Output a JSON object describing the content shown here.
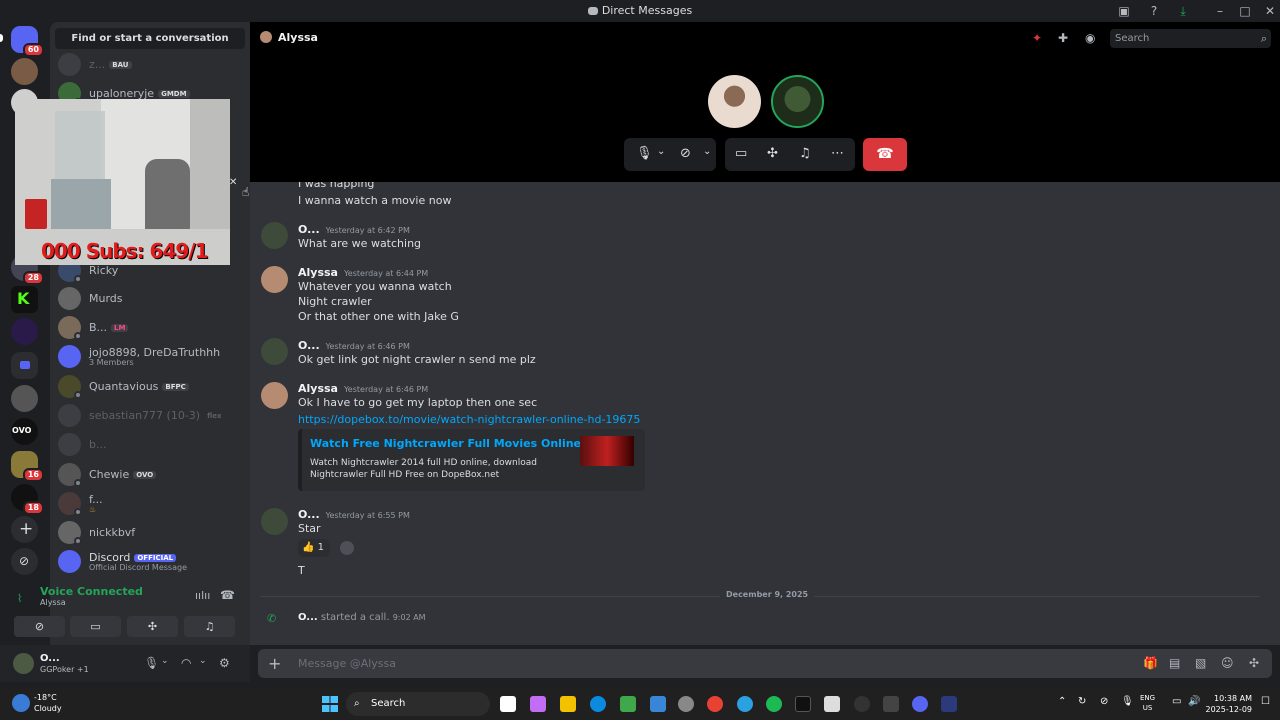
{
  "window": {
    "title": "Direct Messages"
  },
  "rail": {
    "badges": {
      "home": "60",
      "s1": "28",
      "s2": "16",
      "s3": "18"
    }
  },
  "sidebar": {
    "find_placeholder": "Find or start a conversation",
    "dms": [
      {
        "name": "z...",
        "tag": "BAU"
      },
      {
        "name": "upaloneryje",
        "tag": "GMDM"
      },
      {
        "name": "Ricky",
        "tag": ""
      },
      {
        "name": "Murds",
        "tag": ""
      },
      {
        "name": "B...",
        "tag": "LM"
      },
      {
        "name": "jojo8898, DreDaTruthhh",
        "sub": "3 Members",
        "tag": ""
      },
      {
        "name": "Quantavious",
        "tag": "BFPC"
      },
      {
        "name": "sebastian777 (10-3)",
        "tag": "flex"
      },
      {
        "name": "b...",
        "tag": ""
      },
      {
        "name": "Chewie",
        "tag": "OVO"
      },
      {
        "name": "f...",
        "tag": ""
      },
      {
        "name": "nickkbvf",
        "tag": ""
      },
      {
        "name": "Discord",
        "sub": "Official Discord Message",
        "tag": "OFFICIAL"
      }
    ]
  },
  "pip_overlay": "000 Subs: 649/1",
  "voice": {
    "status": "Voice Connected",
    "channel": "Alyssa"
  },
  "user": {
    "name": "O...",
    "status": "GGPoker +1"
  },
  "header": {
    "channel": "Alyssa",
    "search_placeholder": "Search"
  },
  "messages": [
    {
      "line": "I was napping"
    },
    {
      "line": "I wanna watch a movie now"
    },
    {
      "author": "O...",
      "time": "Yesterday at 6:42 PM",
      "lines": [
        "What are we watching"
      ]
    },
    {
      "author": "Alyssa",
      "time": "Yesterday at 6:44 PM",
      "lines": [
        "Whatever you wanna watch",
        "Night crawler",
        "Or that other one with Jake G"
      ]
    },
    {
      "author": "O...",
      "time": "Yesterday at 6:46 PM",
      "lines": [
        "Ok get link got night crawler n send me plz"
      ]
    },
    {
      "author": "Alyssa",
      "time": "Yesterday at 6:46 PM",
      "lines": [
        "Ok I have to go get my laptop then  one sec"
      ],
      "link": "https://dopebox.to/movie/watch-nightcrawler-online-hd-19675",
      "embed": {
        "title": "Watch Free Nightcrawler Full Movies Online",
        "desc": "Watch Nightcrawler 2014 full HD online, download Nightcrawler Full HD Free on DopeBox.net"
      }
    },
    {
      "author": "O...",
      "time": "Yesterday at 6:55 PM",
      "lines": [
        "Star"
      ],
      "reaction_count": "1",
      "extra": "T"
    }
  ],
  "divider": "December 9, 2025",
  "call_event": {
    "author": "O...",
    "text": "started a call.",
    "time": "9:02 AM"
  },
  "composer": {
    "placeholder": "Message @Alyssa"
  },
  "taskbar": {
    "temp": "-18°C",
    "weather": "Cloudy",
    "search": "Search",
    "lang1": "ENG",
    "lang2": "US",
    "time": "10:38 AM",
    "date": "2025-12-09"
  }
}
